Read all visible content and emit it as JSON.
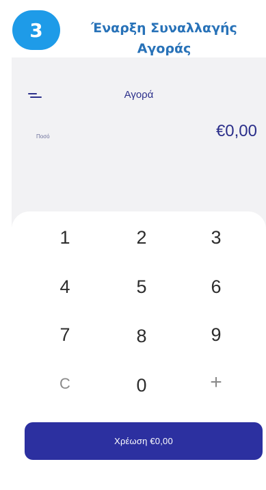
{
  "step": {
    "number": "3",
    "title": "Έναρξη Συναλλαγής Αγοράς"
  },
  "app": {
    "title": "Αγορά",
    "amount_label": "Ποσό",
    "amount_value": "€0,00",
    "menu_icon": "menu-icon"
  },
  "keypad": {
    "keys": [
      "1",
      "2",
      "3",
      "4",
      "5",
      "6",
      "7",
      "8",
      "9",
      "C",
      "0",
      "+"
    ]
  },
  "charge_button": {
    "label": "Χρέωση  €0,00"
  },
  "colors": {
    "badge": "#1e9be8",
    "title": "#2872b8",
    "primary": "#2c30a0",
    "background": "#f2f2f4"
  }
}
